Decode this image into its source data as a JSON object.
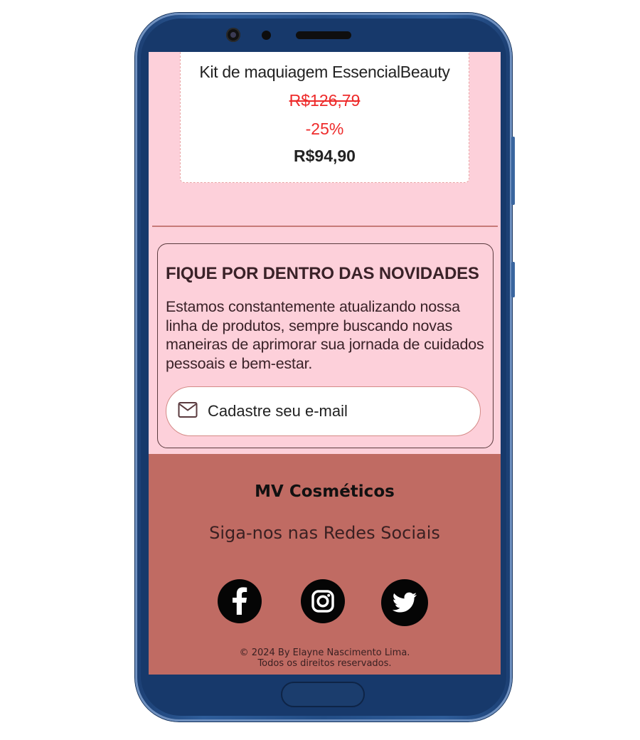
{
  "product": {
    "name": "Kit de maquiagem EssencialBeauty",
    "old_price": "R$126,79",
    "discount": "-25%",
    "price": "R$94,90"
  },
  "newsletter": {
    "title": "FIQUE POR DENTRO DAS NOVIDADES",
    "text": "Estamos constantemente atualizando nossa linha de produtos, sempre buscando novas maneiras de aprimorar sua jornada de cuidados pessoais e bem-estar.",
    "email_placeholder": "Cadastre seu e-mail",
    "email_icon": "mail-icon"
  },
  "footer": {
    "brand": "MV Cosméticos",
    "follow_text": "Siga-nos nas Redes Sociais",
    "social": [
      {
        "name": "facebook",
        "icon": "facebook-icon"
      },
      {
        "name": "instagram",
        "icon": "instagram-icon"
      },
      {
        "name": "twitter",
        "icon": "twitter-icon"
      }
    ],
    "copyright_line1": "© 2024 By Elayne Nascimento Lima.",
    "copyright_line2": "Todos os direitos reservados."
  },
  "colors": {
    "screen_bg": "#fdd0da",
    "footer_bg": "#c06b63",
    "price_red": "#ee2b2b",
    "phone_frame": "#234d86"
  }
}
